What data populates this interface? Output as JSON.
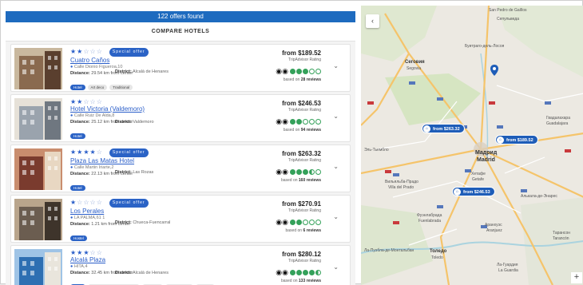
{
  "results": {
    "banner": "122 offers found",
    "compare_label": "COMPARE HOTELS"
  },
  "hotels": [
    {
      "stars": 2,
      "special": "Special offer",
      "name": "Cuatro Caños",
      "address": "Calle Dionio Figueroa,10",
      "distance_label": "Distance:",
      "distance": "29.54 km from center",
      "district_label": "District:",
      "district": "Alcalá de Henares",
      "tags": [
        "Hotel",
        "Art deco",
        "Traditional"
      ],
      "price": "from $189.52",
      "rating_label": "TripAdvisor Rating",
      "bubbles": 3,
      "based_prefix": "based on",
      "reviews": "28 reviews"
    },
    {
      "stars": 2,
      "special": "",
      "name": "Hotel Victoria (Valdemoro)",
      "address": "Calle Ruiz De Alda,8",
      "distance_label": "Distance:",
      "distance": "25.12 km from center",
      "district_label": "District:",
      "district": "Valdemoro",
      "tags": [
        "Hotel"
      ],
      "price": "from $246.53",
      "rating_label": "TripAdvisor Rating",
      "bubbles": 2,
      "based_prefix": "based on",
      "reviews": "94 reviews"
    },
    {
      "stars": 4,
      "special": "Special offer",
      "name": "Plaza Las Matas Hotel",
      "address": "Calle Martin Iriarte,2",
      "distance_label": "Distance:",
      "distance": "22.13 km from center",
      "district_label": "District:",
      "district": "Las Rozas",
      "tags": [
        "Hotel"
      ],
      "price": "from $263.32",
      "rating_label": "TripAdvisor Rating",
      "bubbles": 3.5,
      "based_prefix": "based on",
      "reviews": "160 reviews"
    },
    {
      "stars": 1,
      "special": "Special offer",
      "name": "Los Perales",
      "address": "LA PALMA,61 1",
      "distance_label": "Distance:",
      "distance": "1.21 km from center",
      "district_label": "District:",
      "district": "Chueca-Fuencarral",
      "tags": [
        "Hostel"
      ],
      "price": "from $270.91",
      "rating_label": "TripAdvisor Rating",
      "bubbles": 2,
      "based_prefix": "based on",
      "reviews": "6 reviews"
    },
    {
      "stars": 3,
      "special": "",
      "name": "Alcalá Plaza",
      "address": "HITA,4",
      "distance_label": "Distance:",
      "distance": "32.45 km from center",
      "district_label": "District:",
      "district": "Alcalá de Henares",
      "tags": [
        "Hotel",
        "Corporate business transient",
        "Business",
        "Pets Friendly",
        "Art deco"
      ],
      "price": "from $280.12",
      "rating_label": "TripAdvisor Rating",
      "bubbles": 4.5,
      "based_prefix": "based on",
      "reviews": "133 reviews"
    }
  ],
  "map": {
    "back_glyph": "‹",
    "zoom_glyph": "+",
    "price_pins": [
      "from $263.32",
      "from $189.52",
      "from $246.53"
    ],
    "labels": {
      "madrid_ru": "Мадрид",
      "madrid": "Madrid",
      "segovia_ru": "Сеговия",
      "segovia": "Segovia",
      "getafe_ru": "Хетафе",
      "getafe": "Getafe",
      "guadalajara_ru": "Гвадалахара",
      "guadalajara": "Guadalajara",
      "aranjuez_ru": "Аранхуэс",
      "aranjuez": "Aranjuez",
      "toledo_ru": "Толедо",
      "toledo": "Toledo",
      "alcala_ru": "Алькала-де-Энарес",
      "fuenlabrada_ru": "Фуэнлабрада",
      "fuenlabrada": "Fuenlabrada",
      "villa_ru": "Вильяльба-Прадо",
      "villa": "Villa del Prado",
      "burgos": "Буитраго-дель-Лосоя",
      "talavera": "Ла-Пуэбла-де-Монтальбан",
      "ocana_ru": "Ла-Гуардия",
      "ocana": "La Guardia",
      "roma": "San Pedro de Gaíllos",
      "sep": "Сепульведа",
      "tarancon_ru": "Тарансон",
      "tarancon": "Tarancón",
      "avila": "Эль-Тьембло"
    },
    "colors": {
      "road": "#f5c46a",
      "highway": "#ffffff",
      "water": "#aad3df",
      "park": "#cde3b5",
      "pin": "#1e5db8"
    }
  }
}
